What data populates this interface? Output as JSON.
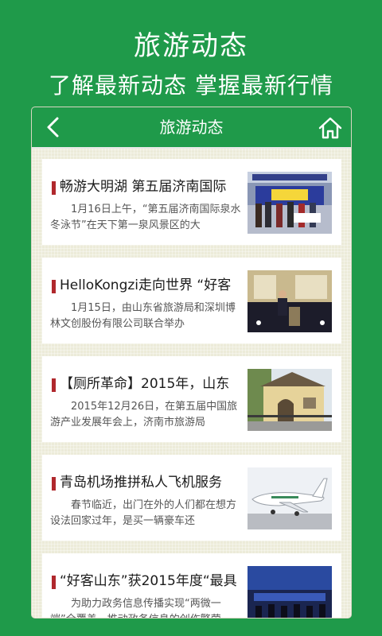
{
  "promo": {
    "title": "旅游动态",
    "subtitle": "了解最新动态 掌握最新行情"
  },
  "appbar": {
    "title": "旅游动态",
    "back_icon": "chevron-left-icon",
    "home_icon": "home-icon"
  },
  "colors": {
    "brand_green": "#1f9a4a",
    "accent_red": "#b0282d",
    "list_bg": "#ecebd9"
  },
  "articles": [
    {
      "title": "畅游大明湖 第五届济南国际",
      "summary": "1月16日上午，“第五届济南国际泉水冬泳节”在天下第一泉风景区的大",
      "thumbnail": "banner-ceremony-photo"
    },
    {
      "title": "HelloKongzi走向世界 “好客",
      "summary": "1月15日，由山东省旅游局和深圳博林文创股份有限公司联合举办",
      "thumbnail": "stage-speaker-photo"
    },
    {
      "title": "【厕所革命】2015年，山东",
      "summary": "2015年12月26日，在第五届中国旅游产业发展年会上，济南市旅游局",
      "thumbnail": "building-photo"
    },
    {
      "title": "青岛机场推拼私人飞机服务",
      "summary": "春节临近，出门在外的人们都在想方设法回家过年，是买一辆豪车还",
      "thumbnail": "jet-photo"
    },
    {
      "title": "“好客山东”获2015年度“最具",
      "summary": "为助力政务信息传播实现“两微一端”全覆盖，推动政务信息的创作繁荣",
      "thumbnail": "conference-photo"
    }
  ]
}
